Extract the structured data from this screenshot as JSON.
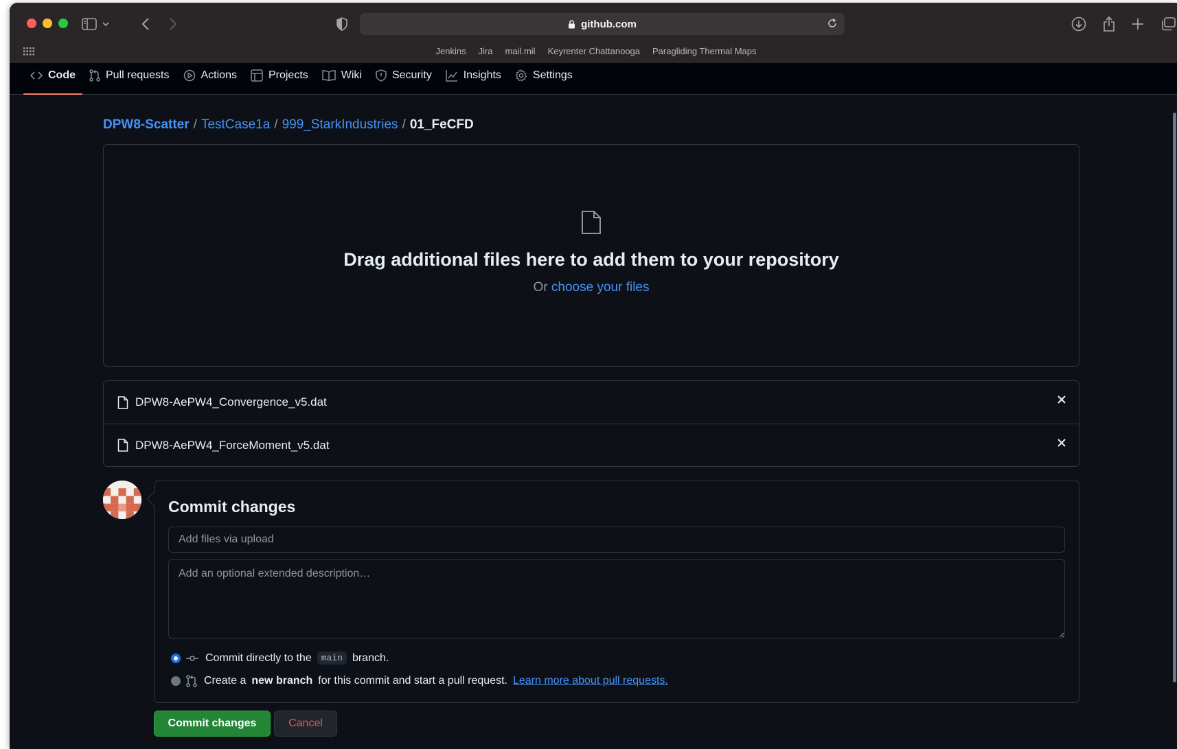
{
  "browser": {
    "url": "github.com",
    "bookmarks": [
      "Jenkins",
      "Jira",
      "mail.mil",
      "Keyrenter Chattanooga",
      "Paragliding Thermal Maps"
    ]
  },
  "repo_nav": {
    "tabs": [
      {
        "label": "Code",
        "icon": "code-icon",
        "active": true
      },
      {
        "label": "Pull requests",
        "icon": "pull-request-icon"
      },
      {
        "label": "Actions",
        "icon": "play-icon"
      },
      {
        "label": "Projects",
        "icon": "table-icon"
      },
      {
        "label": "Wiki",
        "icon": "book-icon"
      },
      {
        "label": "Security",
        "icon": "shield-icon"
      },
      {
        "label": "Insights",
        "icon": "graph-icon"
      },
      {
        "label": "Settings",
        "icon": "gear-icon"
      }
    ]
  },
  "breadcrumb": {
    "owner": "DPW8-Scatter",
    "path": [
      "TestCase1a",
      "999_StarkIndustries"
    ],
    "current": "01_FeCFD",
    "separator": "/"
  },
  "dropzone": {
    "title": "Drag additional files here to add them to your repository",
    "or_text": "Or",
    "choose_link": "choose your files"
  },
  "files": [
    {
      "name": "DPW8-AePW4_Convergence_v5.dat"
    },
    {
      "name": "DPW8-AePW4_ForceMoment_v5.dat"
    }
  ],
  "commit": {
    "title": "Commit changes",
    "summary_placeholder": "Add files via upload",
    "description_placeholder": "Add an optional extended description…",
    "option_direct": {
      "prefix": "Commit directly to the",
      "branch": "main",
      "suffix": "branch."
    },
    "option_new_branch": {
      "prefix": "Create a",
      "bold": "new branch",
      "suffix": "for this commit and start a pull request.",
      "link": "Learn more about pull requests."
    },
    "submit_label": "Commit changes",
    "cancel_label": "Cancel"
  },
  "colors": {
    "background": "#0d1117",
    "link": "#4493f8",
    "primary_button": "#238636",
    "danger": "#f85149",
    "active_tab_underline": "#f78166"
  }
}
